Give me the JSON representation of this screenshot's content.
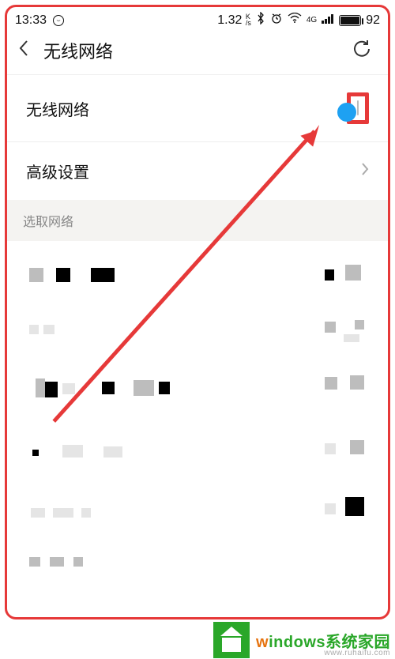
{
  "status": {
    "time": "13:33",
    "speed_num": "1.32",
    "speed_unit_top": "K",
    "speed_unit_bot": "/s",
    "network_type": "4G",
    "battery_pct": "92"
  },
  "nav": {
    "title": "无线网络"
  },
  "rows": {
    "wlan_label": "无线网络",
    "advanced_label": "高级设置"
  },
  "section": {
    "select_network": "选取网络"
  },
  "watermark": {
    "logo_initial": "w",
    "brand_rest": "indows系统家园",
    "url": "www.ruhaifu.com"
  }
}
